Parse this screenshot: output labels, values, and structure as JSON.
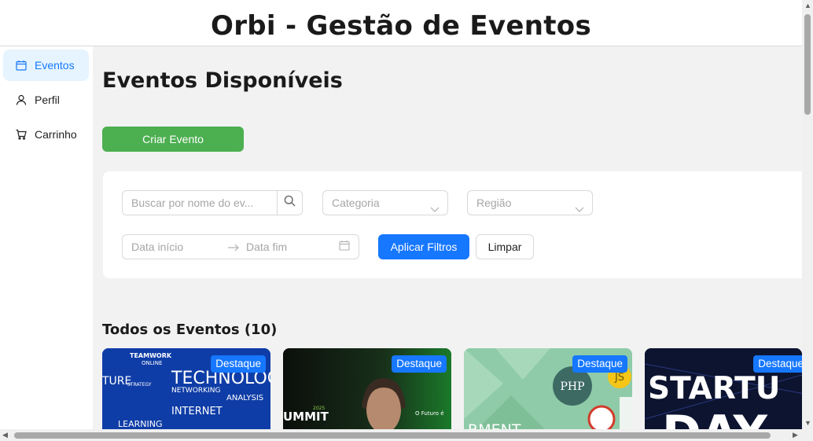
{
  "app": {
    "title": "Orbi - Gestão de Eventos"
  },
  "sidebar": {
    "items": [
      {
        "label": "Eventos",
        "icon": "calendar-icon",
        "active": true
      },
      {
        "label": "Perfil",
        "icon": "user-icon",
        "active": false
      },
      {
        "label": "Carrinho",
        "icon": "cart-icon",
        "active": false
      }
    ]
  },
  "main": {
    "title": "Eventos Disponíveis",
    "create_button": "Criar Evento",
    "filters": {
      "search_placeholder": "Buscar por nome do ev...",
      "category_placeholder": "Categoria",
      "region_placeholder": "Região",
      "date_start_placeholder": "Data início",
      "date_end_placeholder": "Data fim",
      "apply_label": "Aplicar Filtros",
      "clear_label": "Limpar"
    },
    "section_title": "Todos os Eventos (10)",
    "cards": [
      {
        "badge": "Destaque",
        "image_words": [
          "TEAMWORK",
          "ONLINE",
          "TECHNOLOGY",
          "NETWORKING",
          "INTERNET",
          "ANALYSIS",
          "LEARNING",
          "TURE",
          "STRATEGY"
        ]
      },
      {
        "badge": "Destaque",
        "image_words": [
          "UMMIT",
          "2025",
          "O Futuro é"
        ]
      },
      {
        "badge": "Destaque",
        "image_words": [
          "PHP",
          "JS",
          "RMENT"
        ]
      },
      {
        "badge": "Destaque",
        "image_words": [
          "STARTU",
          "DAY"
        ]
      }
    ]
  },
  "colors": {
    "accent": "#1677ff",
    "create": "#4caf50",
    "active_bg": "#e6f4ff",
    "main_bg": "#f2f2f2"
  }
}
